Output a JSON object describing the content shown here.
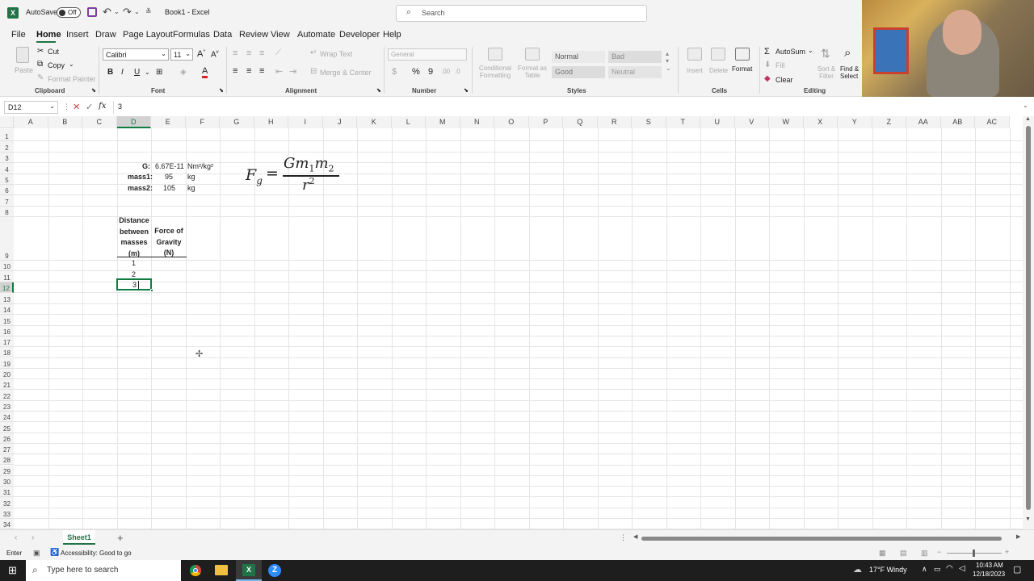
{
  "title_bar": {
    "autosave_label": "AutoSave",
    "autosave_state": "Off",
    "doc_title": "Book1 - Excel",
    "search_placeholder": "Search"
  },
  "menu": [
    "File",
    "Home",
    "Insert",
    "Draw",
    "Page Layout",
    "Formulas",
    "Data",
    "Review",
    "View",
    "Automate",
    "Developer",
    "Help"
  ],
  "ribbon": {
    "clipboard": {
      "paste": "Paste",
      "cut": "Cut",
      "copy": "Copy",
      "format_painter": "Format Painter",
      "label": "Clipboard"
    },
    "font": {
      "name": "Calibri",
      "size": "11",
      "label": "Font"
    },
    "alignment": {
      "wrap": "Wrap Text",
      "merge": "Merge & Center",
      "label": "Alignment"
    },
    "number": {
      "format": "General",
      "label": "Number"
    },
    "styles": {
      "conditional": "Conditional Formatting",
      "format_as_table": "Format as Table",
      "normal": "Normal",
      "bad": "Bad",
      "good": "Good",
      "neutral": "Neutral",
      "label": "Styles"
    },
    "cells": {
      "insert": "Insert",
      "delete": "Delete",
      "format": "Format",
      "label": "Cells"
    },
    "editing": {
      "autosum": "AutoSum",
      "fill": "Fill",
      "clear": "Clear",
      "sort": "Sort & Filter",
      "find": "Find & Select",
      "label": "Editing"
    }
  },
  "formula_bar": {
    "name_box": "D12",
    "fx": "fx",
    "value": "3"
  },
  "columns": [
    "A",
    "B",
    "C",
    "D",
    "E",
    "F",
    "G",
    "H",
    "I",
    "J",
    "K",
    "L",
    "M",
    "N",
    "O",
    "P",
    "Q",
    "R",
    "S",
    "T",
    "U",
    "V",
    "W",
    "X",
    "Y",
    "Z",
    "AA",
    "AB",
    "AC"
  ],
  "rows": [
    "1",
    "2",
    "3",
    "4",
    "5",
    "6",
    "7",
    "8",
    "9",
    "10",
    "11",
    "12",
    "13",
    "14",
    "15",
    "16",
    "17",
    "18",
    "19",
    "20",
    "21",
    "22",
    "23",
    "24",
    "25",
    "26",
    "27",
    "28",
    "29",
    "30",
    "31",
    "32",
    "33",
    "34"
  ],
  "cells": {
    "g_label": "G:",
    "g_value": "6.67E-11",
    "g_unit": "Nm²/kg²",
    "m1_label": "mass1:",
    "m1_value": "95",
    "m1_unit": "kg",
    "m2_label": "mass2:",
    "m2_value": "105",
    "m2_unit": "kg",
    "hdr_d": [
      "Distance",
      "between",
      "masses",
      "(m)"
    ],
    "hdr_e": [
      "Force of",
      "Gravity",
      "(N)"
    ],
    "d10": "1",
    "d11": "2",
    "d12": "3"
  },
  "equation": {
    "lhs": "F",
    "lhs_sub": "g",
    "eq": "=",
    "num": "Gm",
    "num_sub1": "1",
    "num_m": "m",
    "num_sub2": "2",
    "den": "r",
    "den_sup": "2"
  },
  "sheet_tab": "Sheet1",
  "status": {
    "mode": "Enter",
    "accessibility": "Accessibility: Good to go"
  },
  "taskbar": {
    "search": "Type here to search",
    "weather": "17°F  Windy",
    "time": "10:43 AM",
    "date": "12/18/2023"
  },
  "colors": {
    "excel_green": "#217346",
    "selection": "#107c41"
  }
}
